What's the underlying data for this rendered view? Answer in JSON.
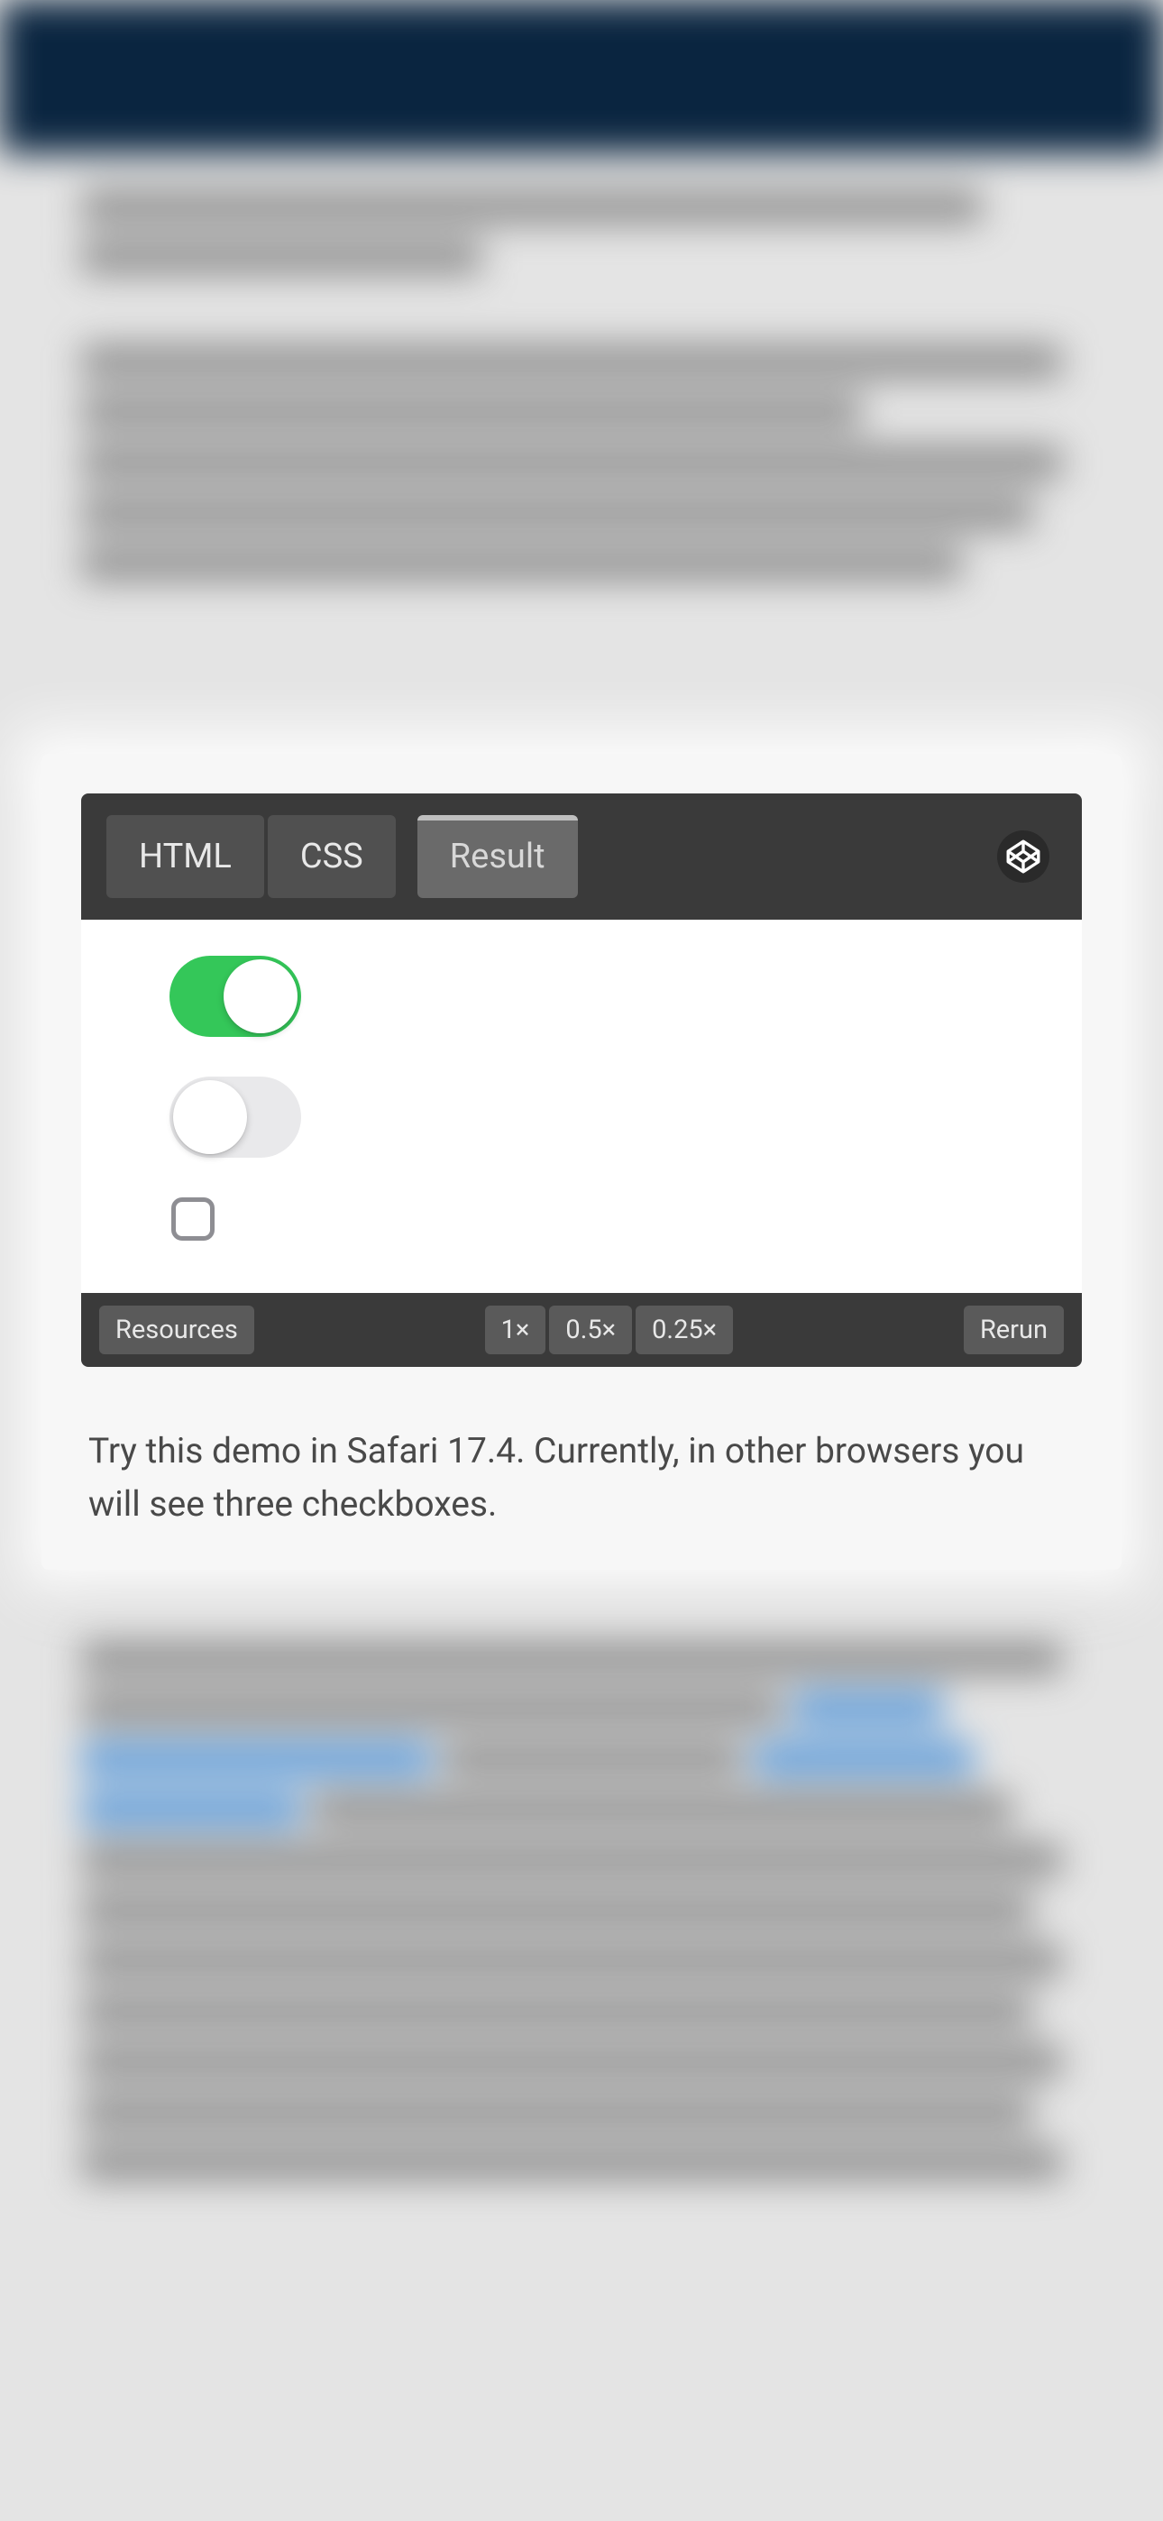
{
  "codepen": {
    "tabs": {
      "html": "HTML",
      "css": "CSS",
      "result": "Result"
    },
    "footer": {
      "resources": "Resources",
      "zoom_1x": "1×",
      "zoom_05x": "0.5×",
      "zoom_025x": "0.25×",
      "rerun": "Rerun"
    }
  },
  "switches": {
    "switch1_on": true,
    "switch2_on": false
  },
  "caption": "Try this demo in Safari 17.4. Currently, in other browsers you will see three checkboxes."
}
